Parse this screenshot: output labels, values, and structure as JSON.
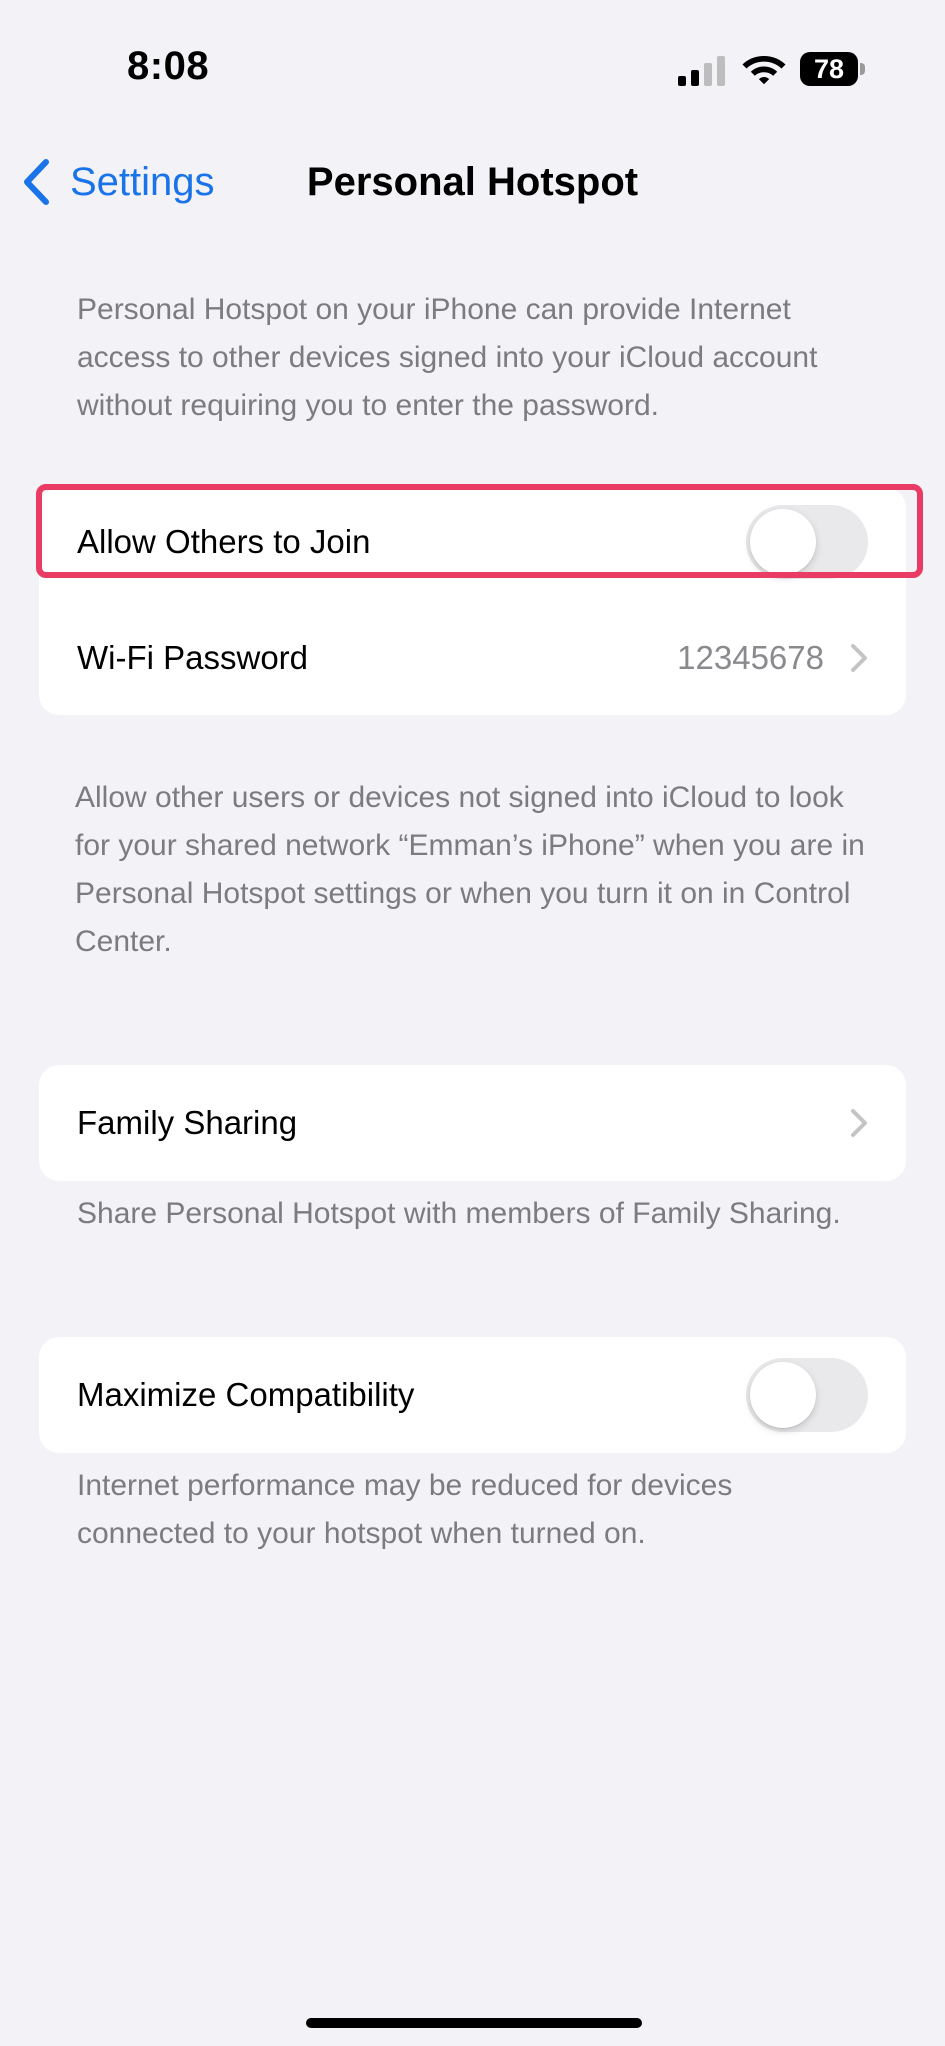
{
  "status_bar": {
    "time": "8:08",
    "battery": "78",
    "icons": [
      "cellular-signal-icon",
      "wifi-icon",
      "battery-icon"
    ]
  },
  "nav": {
    "back_label": "Settings",
    "title": "Personal Hotspot"
  },
  "intro": "Personal Hotspot on your iPhone can provide Internet access to other devices signed into your iCloud account without requiring you to enter the password.",
  "group1": {
    "allow_others": {
      "label": "Allow Others to Join",
      "on": false
    },
    "wifi_password": {
      "label": "Wi-Fi Password",
      "value": "12345678"
    }
  },
  "group1_footer": "Allow other users or devices not signed into iCloud to look for your shared network “Emman’s iPhone” when you are in Personal Hotspot settings or when you turn it on in Control Center.",
  "family_sharing": {
    "label": "Family Sharing",
    "footer": "Share Personal Hotspot with members of Family Sharing."
  },
  "maximize": {
    "label": "Maximize Compatibility",
    "on": false,
    "footer": "Internet performance may be reduced for devices connected to your hotspot when turned on."
  },
  "colors": {
    "accent": "#1a73e8",
    "background": "#f2f2f7",
    "highlight": "#ea3b64",
    "secondary_text": "#7c7c80"
  }
}
